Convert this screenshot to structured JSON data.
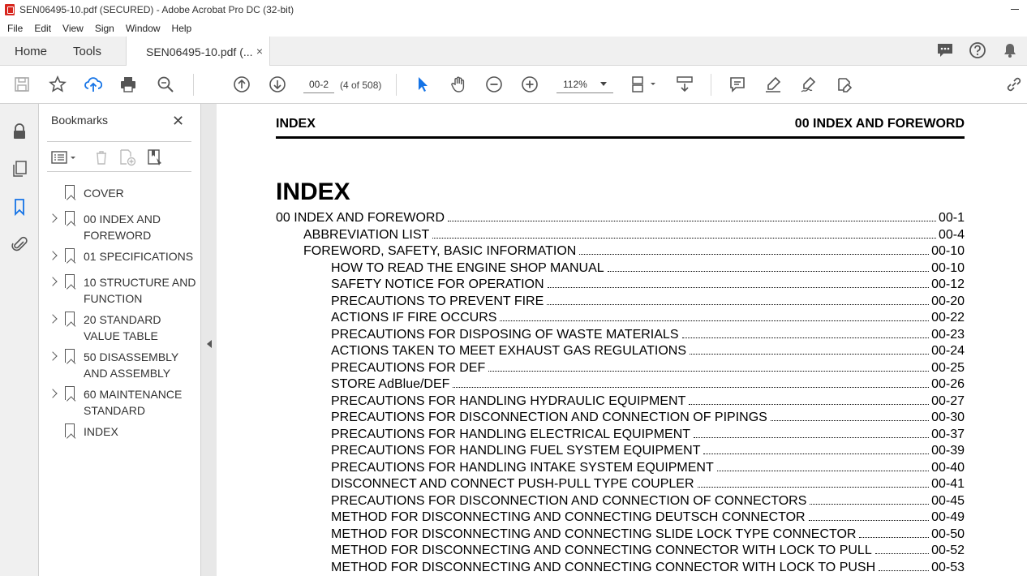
{
  "window": {
    "title": "SEN06495-10.pdf (SECURED) - Adobe Acrobat Pro DC (32-bit)"
  },
  "menu": [
    "File",
    "Edit",
    "View",
    "Sign",
    "Window",
    "Help"
  ],
  "tabs": {
    "home": "Home",
    "tools": "Tools",
    "document": "SEN06495-10.pdf (...",
    "close": "×"
  },
  "toolbar": {
    "page_value": "00-2",
    "page_count": "(4 of 508)",
    "zoom": "112%"
  },
  "bookmarks": {
    "title": "Bookmarks",
    "close": "✕",
    "items": [
      {
        "label": "COVER",
        "expandable": false
      },
      {
        "label": "00 INDEX AND FOREWORD",
        "expandable": true
      },
      {
        "label": "01 SPECIFICATIONS",
        "expandable": true
      },
      {
        "label": "10 STRUCTURE AND FUNCTION",
        "expandable": true
      },
      {
        "label": "20 STANDARD VALUE TABLE",
        "expandable": true
      },
      {
        "label": "50 DISASSEMBLY AND ASSEMBLY",
        "expandable": true
      },
      {
        "label": "60 MAINTENANCE STANDARD",
        "expandable": true
      },
      {
        "label": "INDEX",
        "expandable": false
      }
    ]
  },
  "document": {
    "running_left": "INDEX",
    "running_right": "00 INDEX AND FOREWORD",
    "heading": "INDEX",
    "toc": [
      {
        "text": "00 INDEX AND FOREWORD",
        "page": "00-1",
        "level": 0
      },
      {
        "text": "ABBREVIATION LIST",
        "page": "00-4",
        "level": 1
      },
      {
        "text": "FOREWORD, SAFETY, BASIC INFORMATION",
        "page": "00-10",
        "level": 1
      },
      {
        "text": "HOW TO READ THE ENGINE SHOP MANUAL",
        "page": "00-10",
        "level": 2
      },
      {
        "text": "SAFETY NOTICE FOR OPERATION",
        "page": "00-12",
        "level": 2
      },
      {
        "text": "PRECAUTIONS TO PREVENT FIRE",
        "page": "00-20",
        "level": 2
      },
      {
        "text": "ACTIONS IF FIRE OCCURS",
        "page": "00-22",
        "level": 2
      },
      {
        "text": "PRECAUTIONS FOR DISPOSING OF WASTE MATERIALS",
        "page": "00-23",
        "level": 2
      },
      {
        "text": "ACTIONS TAKEN TO MEET EXHAUST GAS REGULATIONS",
        "page": "00-24",
        "level": 2
      },
      {
        "text": "PRECAUTIONS FOR DEF",
        "page": "00-25",
        "level": 2
      },
      {
        "text": "STORE AdBlue/DEF",
        "page": "00-26",
        "level": 2
      },
      {
        "text": "PRECAUTIONS FOR HANDLING HYDRAULIC EQUIPMENT",
        "page": "00-27",
        "level": 2
      },
      {
        "text": "PRECAUTIONS FOR DISCONNECTION AND CONNECTION OF PIPINGS",
        "page": "00-30",
        "level": 2
      },
      {
        "text": "PRECAUTIONS FOR HANDLING ELECTRICAL EQUIPMENT",
        "page": "00-37",
        "level": 2
      },
      {
        "text": "PRECAUTIONS FOR HANDLING FUEL SYSTEM EQUIPMENT",
        "page": "00-39",
        "level": 2
      },
      {
        "text": "PRECAUTIONS FOR HANDLING INTAKE SYSTEM EQUIPMENT",
        "page": "00-40",
        "level": 2
      },
      {
        "text": "DISCONNECT AND CONNECT PUSH-PULL TYPE COUPLER",
        "page": "00-41",
        "level": 2
      },
      {
        "text": "PRECAUTIONS FOR DISCONNECTION AND CONNECTION OF CONNECTORS",
        "page": "00-45",
        "level": 2
      },
      {
        "text": "METHOD FOR DISCONNECTING AND CONNECTING DEUTSCH CONNECTOR",
        "page": "00-49",
        "level": 2
      },
      {
        "text": "METHOD FOR DISCONNECTING AND CONNECTING SLIDE LOCK TYPE CONNECTOR",
        "page": "00-50",
        "level": 2
      },
      {
        "text": "METHOD FOR DISCONNECTING AND CONNECTING CONNECTOR WITH LOCK TO PULL",
        "page": "00-52",
        "level": 2
      },
      {
        "text": "METHOD FOR DISCONNECTING AND CONNECTING CONNECTOR WITH LOCK TO PUSH",
        "page": "00-53",
        "level": 2
      }
    ]
  },
  "colors": {
    "accent": "#1473e6",
    "app_icon": "#d7261e"
  },
  "icons": [
    "save-icon",
    "star-icon",
    "upload-icon",
    "print-icon",
    "zoom-search-icon",
    "page-up-icon",
    "page-down-icon",
    "select-arrow-icon",
    "hand-icon",
    "zoom-out-icon",
    "zoom-in-icon",
    "page-layout-icon",
    "scroll-icon",
    "comment-icon",
    "highlight-pen-icon",
    "sign-icon",
    "edit-icon",
    "link-icon",
    "chat-icon",
    "help-icon",
    "bell-icon",
    "lock-icon",
    "pages-icon",
    "bookmark-icon",
    "attachment-icon"
  ]
}
